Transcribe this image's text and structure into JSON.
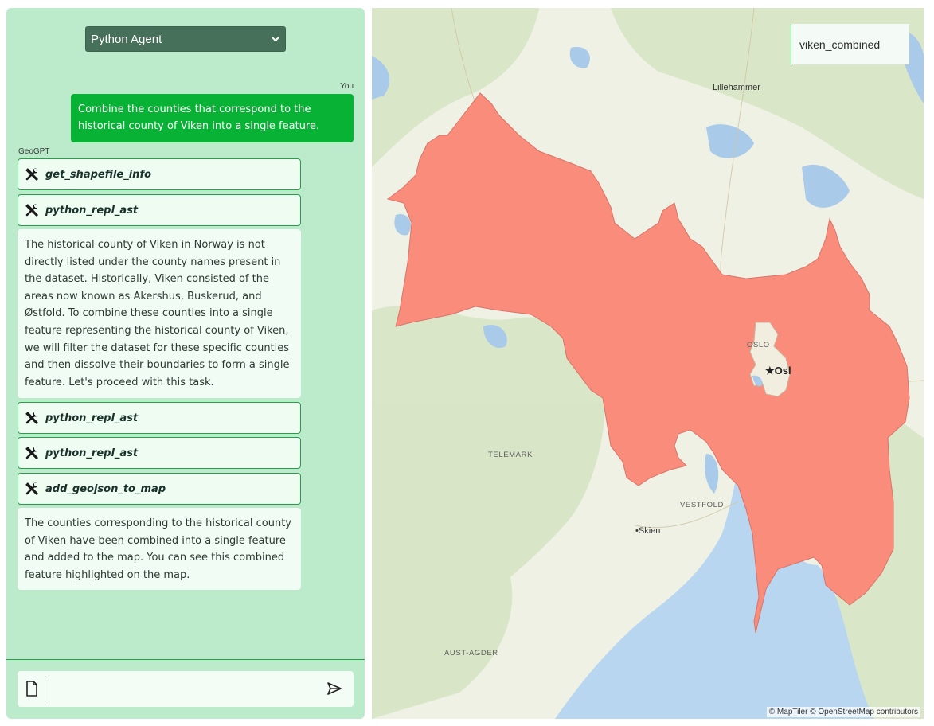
{
  "header": {
    "agent_select_value": "Python Agent"
  },
  "chat": {
    "user_label": "You",
    "user_message": "Combine the counties that correspond to the historical county of Viken into a single feature.",
    "bot_label": "GeoGPT",
    "tool_calls": [
      {
        "name": "get_shapefile_info"
      },
      {
        "name": "python_repl_ast"
      },
      {
        "name": "python_repl_ast"
      },
      {
        "name": "python_repl_ast"
      },
      {
        "name": "add_geojson_to_map"
      }
    ],
    "messages": [
      {
        "text": "The historical county of Viken in Norway is not directly listed under the county names present in the dataset. Historically, Viken consisted of the areas now known as Akershus, Buskerud, and Østfold. To combine these counties into a single feature representing the historical county of Viken, we will filter the dataset for these specific counties and then dissolve their boundaries to form a single feature. Let's proceed with this task."
      },
      {
        "text": "The counties corresponding to the historical county of Viken have been combined into a single feature and added to the map. You can see this combined feature highlighted on the map."
      }
    ],
    "input": {
      "value": "",
      "placeholder": ""
    }
  },
  "map": {
    "layer_name": "viken_combined",
    "place_labels": {
      "lillehammer": "Lillehammer",
      "oslo_region": "OSLO",
      "oslo_city": "Osl",
      "telemark": "TELEMARK",
      "vestfold": "VESTFOLD",
      "skien": "Skien",
      "aust_agder": "AUST-AGDER"
    },
    "attribution": "© MapTiler © OpenStreetMap contributors",
    "colors": {
      "feature_fill": "#f98c7b",
      "water": "#a9cbe9",
      "land": "#eef1e4",
      "forest": "#d6e4c3",
      "accent_green": "#08b235",
      "panel_bg": "#bcebcb"
    }
  }
}
